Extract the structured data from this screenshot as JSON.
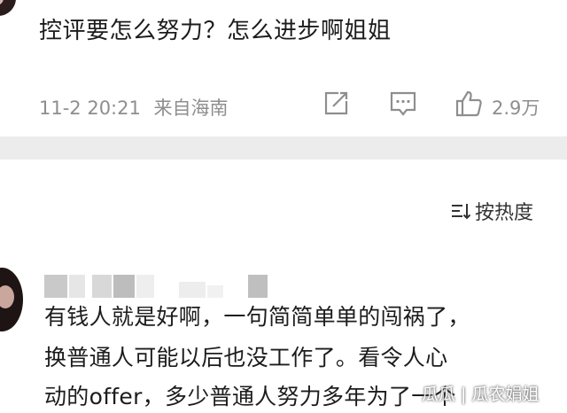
{
  "comment": {
    "text": "控评要怎么努力？怎么进步啊姐姐",
    "time": "11-2 20:21",
    "location": "来自海南",
    "like_count": "2.9万"
  },
  "icons": {
    "share": "share-icon",
    "comment": "comment-icon",
    "like": "thumbs-up-icon",
    "sort": "sort-icon"
  },
  "sort": {
    "label": "按热度"
  },
  "reply": {
    "lines": [
      "有钱人就是好啊，一句简简单单的闯祸了，",
      "换普通人可能以后也没工作了。看令人心",
      "动的offer，多少普通人努力多年为了一个"
    ]
  },
  "watermark": "瓜瓜 | 瓜农娟姐",
  "colors": {
    "meta_gray": "#8e8e8e",
    "divider": "#ececec",
    "text": "#1c1c1c"
  }
}
